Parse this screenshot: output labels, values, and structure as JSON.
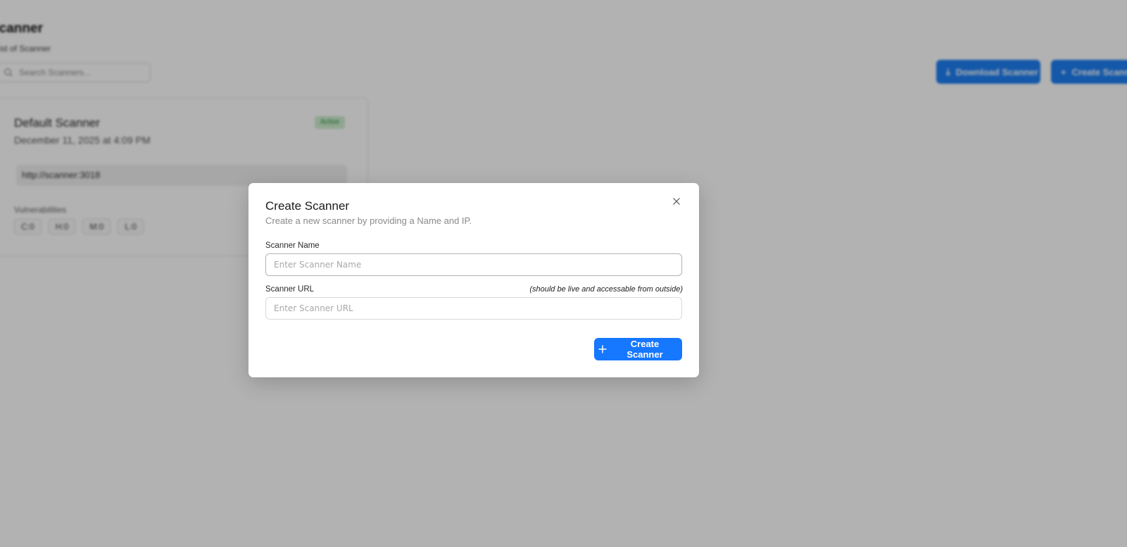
{
  "page": {
    "title": "Scanner",
    "subtitle": "List of Scanner",
    "search_placeholder": "Search Scanners...",
    "download_button": "Download Scanner",
    "create_button": "Create Scanner",
    "card": {
      "name": "Default Scanner",
      "date": "December 11, 2025 at 4:09 PM",
      "status": "Active",
      "url": "http://scanner:3018",
      "vulnerabilities_label": "Vulnerabilities",
      "chips": [
        "C:0",
        "H:0",
        "M:0",
        "L:0"
      ]
    }
  },
  "modal": {
    "title": "Create Scanner",
    "description": "Create a new scanner by providing a Name and IP.",
    "name_label": "Scanner Name",
    "name_placeholder": "Enter Scanner Name",
    "name_value": "",
    "url_label": "Scanner URL",
    "url_hint": "(should be live and accessable from outside)",
    "url_placeholder": "Enter Scanner URL",
    "url_value": "",
    "submit_label": "Create Scanner",
    "close_icon": "close-icon",
    "submit_icon": "plus-icon"
  },
  "colors": {
    "primary": "#1677ff",
    "overlay": "rgba(0,0,0,0.30)",
    "status_bg": "#cdeecf",
    "status_text": "#2e8b3a"
  }
}
